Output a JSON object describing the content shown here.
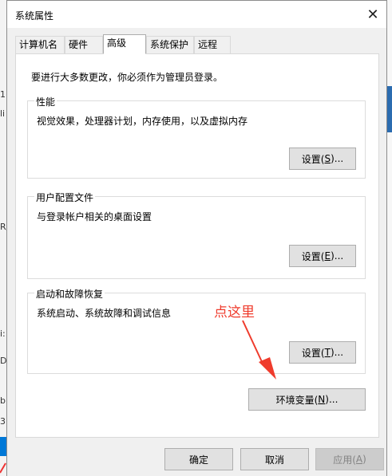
{
  "dialog": {
    "title": "系统属性",
    "close_glyph": "✕"
  },
  "tabs": [
    {
      "label": "计算机名",
      "active": false
    },
    {
      "label": "硬件",
      "active": false
    },
    {
      "label": "高级",
      "active": true
    },
    {
      "label": "系统保护",
      "active": false
    },
    {
      "label": "远程",
      "active": false
    }
  ],
  "panel": {
    "intro": "要进行大多数更改，你必须作为管理员登录。",
    "performance": {
      "legend": "性能",
      "description": "视觉效果，处理器计划，内存使用，以及虚拟内存",
      "button": {
        "text": "设置(",
        "key": "S",
        "suffix": ")..."
      }
    },
    "user_profiles": {
      "legend": "用户配置文件",
      "description": "与登录帐户相关的桌面设置",
      "button": {
        "text": "设置(",
        "key": "E",
        "suffix": ")..."
      }
    },
    "startup_recovery": {
      "legend": "启动和故障恢复",
      "description": "系统启动、系统故障和调试信息",
      "button": {
        "text": "设置(",
        "key": "T",
        "suffix": ")..."
      }
    },
    "env_button": {
      "text": "环境变量(",
      "key": "N",
      "suffix": ")..."
    }
  },
  "annotation": {
    "text": "点这里",
    "color": "#ef3b2c"
  },
  "footer": {
    "ok": "确定",
    "cancel": "取消",
    "apply": {
      "text": "应用(",
      "key": "A",
      "suffix": ")"
    }
  },
  "background": {
    "fragments": [
      "1(",
      "li",
      "R/",
      "i:",
      "D",
      "b:",
      "3:"
    ]
  },
  "colors": {
    "dialog_bg": "#f0f0f0",
    "button_bg": "#e1e1e1",
    "accent_blue": "#0078d7"
  }
}
